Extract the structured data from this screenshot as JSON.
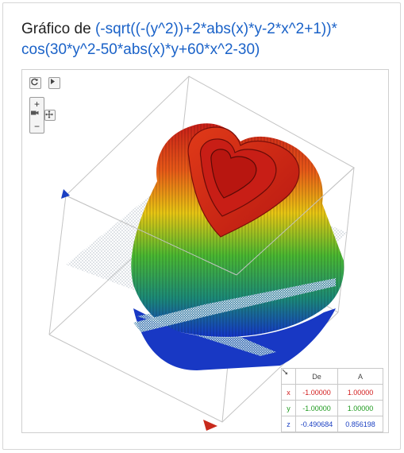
{
  "title": {
    "prefix": "Gráfico de",
    "expression_line1": "(-sqrt((-(y^2))+2*abs(x)*y-2*x^2+1))*",
    "expression_line2": "cos(30*y^2-50*abs(x)*y+60*x^2-30)"
  },
  "controls": {
    "reset_icon": "refresh-icon",
    "play_icon": "play-icon",
    "zoom_in_label": "+",
    "zoom_out_label": "−",
    "camera_icon": "camera-icon",
    "move_icon": "move-icon"
  },
  "range_table": {
    "headers": [
      "De",
      "A"
    ],
    "corner_icon": "arrow-diagonal-icon",
    "rows": [
      {
        "axis": "x",
        "from": "-1.00000",
        "to": "1.00000",
        "color": "#d21c1c"
      },
      {
        "axis": "y",
        "from": "-1.00000",
        "to": "1.00000",
        "color": "#1e9a1e"
      },
      {
        "axis": "z",
        "from": "-0.490684",
        "to": "0.856198",
        "color": "#1a3fc2"
      }
    ]
  },
  "colors": {
    "expression": "#1a62c8",
    "surface_top": "#d0231c",
    "surface_mid": "#e8c414",
    "surface_low": "#28a83c",
    "surface_base": "#1638c6"
  }
}
